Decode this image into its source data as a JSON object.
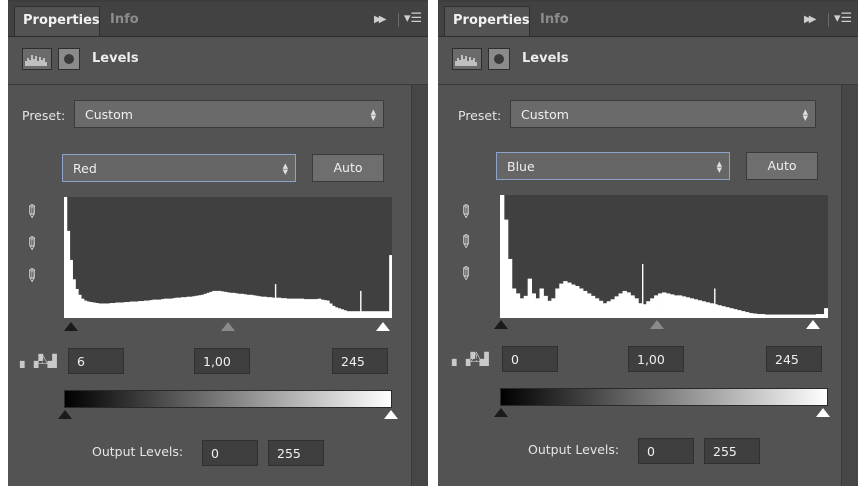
{
  "panels": [
    {
      "tabs": {
        "active": "Properties",
        "inactive": "Info"
      },
      "title": "Levels",
      "preset": {
        "label": "Preset:",
        "value": "Custom"
      },
      "channel": {
        "value": "Red"
      },
      "auto_label": "Auto",
      "input_levels": {
        "black": "6",
        "gamma": "1,00",
        "white": "245"
      },
      "output_levels": {
        "label": "Output Levels:",
        "black": "0",
        "white": "255"
      },
      "histogram": [
        250,
        180,
        120,
        80,
        60,
        48,
        40,
        36,
        34,
        33,
        32,
        31,
        30,
        30,
        30,
        30,
        31,
        31,
        32,
        32,
        32,
        33,
        33,
        34,
        34,
        34,
        35,
        35,
        36,
        36,
        37,
        38,
        38,
        38,
        39,
        40,
        40,
        40,
        41,
        42,
        42,
        43,
        43,
        44,
        44,
        45,
        46,
        47,
        48,
        50,
        52,
        54,
        56,
        56,
        56,
        55,
        54,
        53,
        52,
        52,
        51,
        50,
        50,
        49,
        48,
        48,
        47,
        46,
        45,
        44,
        44,
        43,
        43,
        42,
        42,
        42,
        41,
        41,
        40,
        40,
        40,
        40,
        40,
        40,
        39,
        39,
        39,
        39,
        39,
        40,
        38,
        37,
        36,
        30,
        25,
        22,
        20,
        18,
        16,
        14,
        14,
        14,
        14,
        14,
        14,
        14,
        14,
        14,
        14,
        14,
        14,
        14,
        14,
        14,
        130
      ],
      "histogram_spikes": [
        {
          "pos": 0.645,
          "value": 70
        },
        {
          "pos": 0.905,
          "value": 56
        }
      ]
    },
    {
      "tabs": {
        "active": "Properties",
        "inactive": "Info"
      },
      "title": "Levels",
      "preset": {
        "label": "Preset:",
        "value": "Custom"
      },
      "channel": {
        "value": "Blue"
      },
      "auto_label": "Auto",
      "input_levels": {
        "black": "0",
        "gamma": "1,00",
        "white": "245"
      },
      "output_levels": {
        "label": "Output Levels:",
        "black": "0",
        "white": "255"
      },
      "histogram": [
        250,
        200,
        120,
        60,
        50,
        40,
        45,
        80,
        50,
        40,
        60,
        45,
        35,
        40,
        60,
        70,
        75,
        72,
        68,
        65,
        60,
        55,
        50,
        45,
        40,
        35,
        30,
        34,
        38,
        44,
        50,
        55,
        52,
        46,
        40,
        30,
        28,
        34,
        40,
        46,
        50,
        52,
        50,
        48,
        46,
        46,
        44,
        42,
        40,
        38,
        36,
        34,
        32,
        30,
        28,
        26,
        24,
        22,
        20,
        18,
        16,
        14,
        12,
        10,
        9,
        8,
        8,
        7,
        7,
        7,
        7,
        7,
        7,
        7,
        7,
        7,
        7,
        7,
        7,
        7,
        8,
        8,
        20
      ],
      "histogram_spikes": [
        {
          "pos": 0.435,
          "value": 110
        },
        {
          "pos": 0.655,
          "value": 60
        }
      ]
    }
  ],
  "icons": {
    "forward": "double-forward-icon",
    "menu": "panel-menu-icon",
    "histogram": "histogram-icon",
    "mask": "mask-icon",
    "eyedropper": "eyedropper-icon",
    "clipping": "clipping-warning-icon"
  }
}
